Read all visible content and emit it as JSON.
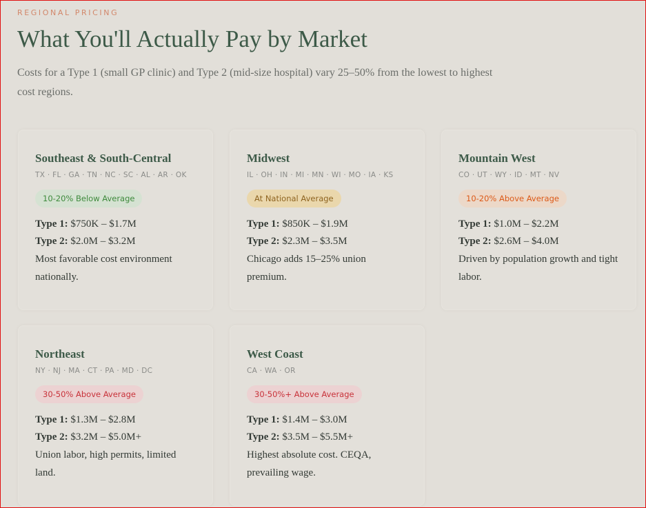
{
  "header": {
    "eyebrow": "Regional Pricing",
    "title": "What You'll Actually Pay by Market",
    "subtitle": "Costs for a Type 1 (small GP clinic) and Type 2 (mid-size hospital) vary 25–50% from the lowest to highest cost regions."
  },
  "labels": {
    "type1": "Type 1:",
    "type2": "Type 2:"
  },
  "regions": [
    {
      "name": "Southeast & South-Central",
      "states": "TX · FL · GA · TN · NC · SC · AL · AR · OK",
      "badge": "10-20% Below Average",
      "type1": "$750K – $1.7M",
      "type2": "$2.0M – $3.2M",
      "note": "Most favorable cost environment nationally."
    },
    {
      "name": "Midwest",
      "states": "IL · OH · IN · MI · MN · WI · MO · IA · KS",
      "badge": "At National Average",
      "type1": "$850K – $1.9M",
      "type2": "$2.3M – $3.5M",
      "note": "Chicago adds 15–25% union premium."
    },
    {
      "name": "Mountain West",
      "states": "CO · UT · WY · ID · MT · NV",
      "badge": "10-20% Above Average",
      "type1": "$1.0M – $2.2M",
      "type2": "$2.6M – $4.0M",
      "note": "Driven by population growth and tight labor."
    },
    {
      "name": "Northeast",
      "states": "NY · NJ · MA · CT · PA · MD · DC",
      "badge": "30-50% Above Average",
      "type1": "$1.3M – $2.8M",
      "type2": "$3.2M – $5.0M+",
      "note": "Union labor, high permits, limited land."
    },
    {
      "name": "West Coast",
      "states": "CA · WA · OR",
      "badge": "30-50%+ Above Average",
      "type1": "$1.4M – $3.0M",
      "type2": "$3.5M – $5.5M+",
      "note": "Highest absolute cost. CEQA, prevailing wage."
    }
  ],
  "colors": {
    "background": "#e2dfd9",
    "heading": "#3d5a48",
    "eyebrow": "#d2876a",
    "below_average": "#3e8a3c",
    "at_average": "#8e6420",
    "above_average": "#dc5a18",
    "far_above_average": "#c8323a"
  }
}
